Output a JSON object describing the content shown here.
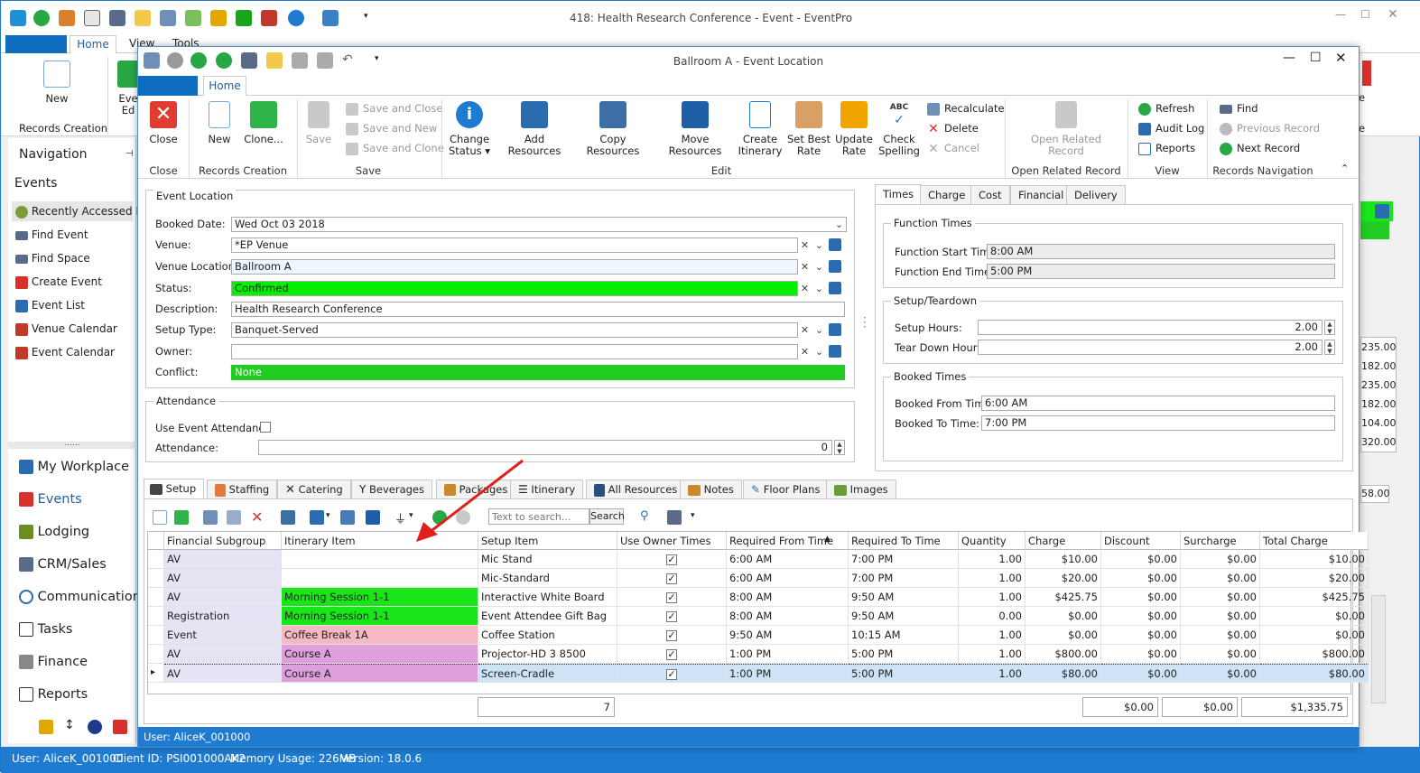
{
  "back_window": {
    "title": "418: Health Research Conference - Event - EventPro",
    "tabs": {
      "home": "Home",
      "view": "View",
      "tools": "Tools"
    },
    "new_label": "New",
    "records_creation": "Records Creation",
    "ev_label": "Eve",
    "ed_label": "Ed"
  },
  "navigation": {
    "title": "Navigation",
    "section": "Events",
    "items": [
      "Recently Accessed Events",
      "Find Event",
      "Find Space",
      "Create Event",
      "Event List",
      "Venue Calendar",
      "Event Calendar"
    ],
    "grip": "......",
    "modules": [
      "My Workplace",
      "Events",
      "Lodging",
      "CRM/Sales",
      "Communications",
      "Tasks",
      "Finance",
      "Reports"
    ]
  },
  "right_strip_values": [
    "235.00",
    "182.00",
    "235.00",
    "182.00",
    "104.00",
    "320.00",
    "58.00"
  ],
  "statusbar": {
    "user": "User: AliceK_001000",
    "client": "Client ID: PSI001000AK2",
    "memory": "Memory Usage: 226MB",
    "version": "Version: 18.0.6"
  },
  "front_window": {
    "title": "Ballroom A - Event Location",
    "tab_home": "Home",
    "ribbon": {
      "close": "Close",
      "new": "New",
      "clone": "Clone...",
      "save": "Save",
      "save_and_close": "Save and Close",
      "save_and_new": "Save and New",
      "save_and_clone": "Save and Clone",
      "change_status": "Change Status",
      "add_resources": "Add Resources",
      "copy_resources": "Copy Resources",
      "move_resources": "Move Resources",
      "create_itinerary": "Create Itinerary",
      "set_best_rate": "Set Best Rate",
      "update_rate": "Update Rate",
      "check_spelling": "Check Spelling",
      "recalculate": "Recalculate",
      "delete": "Delete",
      "cancel": "Cancel",
      "open_related": "Open Related Record",
      "refresh": "Refresh",
      "audit_log": "Audit Log",
      "reports": "Reports",
      "find": "Find",
      "previous_record": "Previous Record",
      "next_record": "Next Record",
      "groups": {
        "close": "Close",
        "records_creation": "Records Creation",
        "save": "Save",
        "edit": "Edit",
        "open_related": "Open Related Record",
        "view": "View",
        "records_navigation": "Records Navigation"
      }
    },
    "event_location": {
      "title": "Event Location",
      "booked_date_label": "Booked Date:",
      "booked_date": "Wed Oct 03 2018",
      "venue_label": "Venue:",
      "venue": "*EP Venue",
      "venue_location_label": "Venue Location:",
      "venue_location": "Ballroom A",
      "status_label": "Status:",
      "status": "Confirmed",
      "description_label": "Description:",
      "description": "Health Research Conference",
      "setup_type_label": "Setup Type:",
      "setup_type": "Banquet-Served",
      "owner_label": "Owner:",
      "owner": "",
      "conflict_label": "Conflict:",
      "conflict": "None"
    },
    "attendance": {
      "title": "Attendance",
      "use_event_label": "Use Event Attendance",
      "attendance_label": "Attendance:",
      "attendance": "0"
    },
    "right_tabs": [
      "Times",
      "Charge",
      "Cost",
      "Financial",
      "Delivery"
    ],
    "function_times": {
      "title": "Function Times",
      "start_label": "Function Start Time:",
      "start": "8:00 AM",
      "end_label": "Function End Time:",
      "end": "5:00 PM"
    },
    "setup_teardown": {
      "title": "Setup/Teardown",
      "setup_label": "Setup Hours:",
      "setup": "2.00",
      "teardown_label": "Tear Down Hours:",
      "teardown": "2.00"
    },
    "booked_times": {
      "title": "Booked Times",
      "from_label": "Booked From Time:",
      "from": "6:00 AM",
      "to_label": "Booked To Time:",
      "to": "7:00 PM"
    },
    "bottom_tabs": [
      "Setup",
      "Staffing",
      "Catering",
      "Beverages",
      "Packages",
      "Itinerary",
      "All Resources",
      "Notes",
      "Floor Plans",
      "Images"
    ],
    "search": {
      "placeholder": "Text to search...",
      "button": "Search"
    },
    "grid": {
      "columns": [
        "Financial Subgroup",
        "Itinerary Item",
        "Setup Item",
        "Use Owner Times",
        "Required From Time",
        "Required To Time",
        "Quantity",
        "Charge",
        "Discount",
        "Surcharge",
        "Total Charge"
      ],
      "rows": [
        {
          "subgroup": "AV",
          "itinerary": "",
          "itin_color": "",
          "setup": "Mic Stand",
          "from": "6:00 AM",
          "to": "7:00 PM",
          "qty": "1.00",
          "charge": "$10.00",
          "discount": "$0.00",
          "surcharge": "$0.00",
          "total": "$10.00"
        },
        {
          "subgroup": "AV",
          "itinerary": "",
          "itin_color": "",
          "setup": "Mic-Standard",
          "from": "6:00 AM",
          "to": "7:00 PM",
          "qty": "1.00",
          "charge": "$20.00",
          "discount": "$0.00",
          "surcharge": "$0.00",
          "total": "$20.00"
        },
        {
          "subgroup": "AV",
          "itinerary": "Morning Session 1-1",
          "itin_color": "#19e619",
          "setup": "Interactive White Board",
          "from": "8:00 AM",
          "to": "9:50 AM",
          "qty": "1.00",
          "charge": "$425.75",
          "discount": "$0.00",
          "surcharge": "$0.00",
          "total": "$425.75"
        },
        {
          "subgroup": "Registration",
          "itinerary": "Morning Session 1-1",
          "itin_color": "#19e619",
          "setup": "Event Attendee Gift Bag",
          "from": "8:00 AM",
          "to": "9:50 AM",
          "qty": "0.00",
          "charge": "$0.00",
          "discount": "$0.00",
          "surcharge": "$0.00",
          "total": "$0.00"
        },
        {
          "subgroup": "Event",
          "itinerary": "Coffee Break 1A",
          "itin_color": "#f5b8c4",
          "setup": "Coffee Station",
          "from": "9:50 AM",
          "to": "10:15 AM",
          "qty": "1.00",
          "charge": "$0.00",
          "discount": "$0.00",
          "surcharge": "$0.00",
          "total": "$0.00"
        },
        {
          "subgroup": "AV",
          "itinerary": "Course A",
          "itin_color": "#dda0dd",
          "setup": "Projector-HD 3 8500",
          "from": "1:00 PM",
          "to": "5:00 PM",
          "qty": "1.00",
          "charge": "$800.00",
          "discount": "$0.00",
          "surcharge": "$0.00",
          "total": "$800.00"
        },
        {
          "subgroup": "AV",
          "itinerary": "Course A",
          "itin_color": "#dda0dd",
          "setup": "Screen-Cradle",
          "from": "1:00 PM",
          "to": "5:00 PM",
          "qty": "1.00",
          "charge": "$80.00",
          "discount": "$0.00",
          "surcharge": "$0.00",
          "total": "$80.00"
        }
      ],
      "footer": {
        "count": "7",
        "discount": "$0.00",
        "surcharge": "$0.00",
        "total": "$1,335.75"
      }
    },
    "status_user": "User: AliceK_001000"
  },
  "colors": {
    "accent": "#1e7bd0",
    "status_green": "#00f000",
    "conflict_green": "#22cc22",
    "subgroup_bg": "#e4e4f5"
  }
}
